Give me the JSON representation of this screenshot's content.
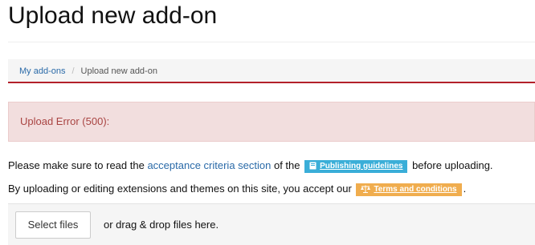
{
  "page": {
    "title": "Upload new add-on"
  },
  "breadcrumb": {
    "items": [
      {
        "label": "My add-ons"
      },
      {
        "label": "Upload new add-on"
      }
    ],
    "separator": "/"
  },
  "alert": {
    "message": "Upload Error (500):"
  },
  "info": {
    "line1_before": "Please make sure to read the ",
    "line1_link": "acceptance criteria section",
    "line1_middle": " of the ",
    "guidelines_label": "Publishing guidelines",
    "line1_after": " before uploading.",
    "line2_before": "By uploading or editing extensions and themes on this site, you accept our ",
    "terms_label": "Terms and conditions",
    "line2_after": "."
  },
  "upload": {
    "select_label": "Select files",
    "drop_text": "or drag & drop files here."
  },
  "colors": {
    "accent_red": "#b3202a",
    "link_blue": "#2a6aa8",
    "info_label": "#3aaed8",
    "warning_label": "#f0ad4e",
    "alert_bg": "#f2dede",
    "alert_text": "#a94442"
  },
  "icons": {
    "guidelines": "book-icon",
    "terms": "scale-icon"
  }
}
